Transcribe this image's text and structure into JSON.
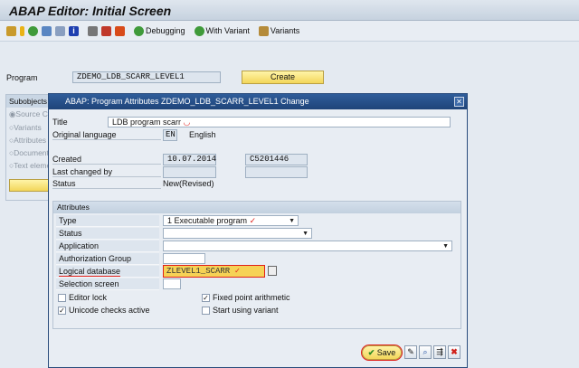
{
  "window": {
    "title": "ABAP Editor: Initial Screen"
  },
  "toolbar": {
    "debugging": "Debugging",
    "with_variant": "With Variant",
    "variants": "Variants",
    "icons": [
      "other-object-icon",
      "active-inactive-icon",
      "execute-icon",
      "where-used-icon",
      "display-object-list-icon",
      "info-icon",
      "delete-icon",
      "copy-icon",
      "rename-icon"
    ]
  },
  "main": {
    "program_label": "Program",
    "program_value": "ZDEMO_LDB_SCARR_LEVEL1",
    "create_label": "Create",
    "subobjects": {
      "title": "Subobjects",
      "items": [
        "Source Code",
        "Variants",
        "Attributes",
        "Documentation",
        "Text elements"
      ],
      "selected": 0
    }
  },
  "dialog": {
    "title": "ABAP: Program Attributes ZDEMO_LDB_SCARR_LEVEL1 Change",
    "title_label": "Title",
    "title_value": "LDB  program scarr",
    "orig_lang_label": "Original language",
    "orig_lang_code": "EN",
    "orig_lang_name": "English",
    "created_label": "Created",
    "created_date": "10.07.2014",
    "created_by": "C5201446",
    "last_changed_label": "Last changed by",
    "status_label": "Status",
    "status_value": "New(Revised)",
    "attributes": {
      "title": "Attributes",
      "type_label": "Type",
      "type_value": "1 Executable program",
      "status_label": "Status",
      "application_label": "Application",
      "auth_group_label": "Authorization Group",
      "ldb_label": "Logical database",
      "ldb_value": "ZLEVEL1_SCARR",
      "selection_screen_label": "Selection screen",
      "editor_lock": {
        "label": "Editor lock",
        "checked": false
      },
      "fixed_point": {
        "label": "Fixed point arithmetic",
        "checked": true
      },
      "unicode": {
        "label": "Unicode checks active",
        "checked": true
      },
      "start_variant": {
        "label": "Start using variant",
        "checked": false
      }
    },
    "footer": {
      "save_label": "Save"
    }
  },
  "colors": {
    "dialog_header": "#1f4479",
    "button_yellow": "#f3d65a",
    "annotation_red": "#e0201a"
  }
}
